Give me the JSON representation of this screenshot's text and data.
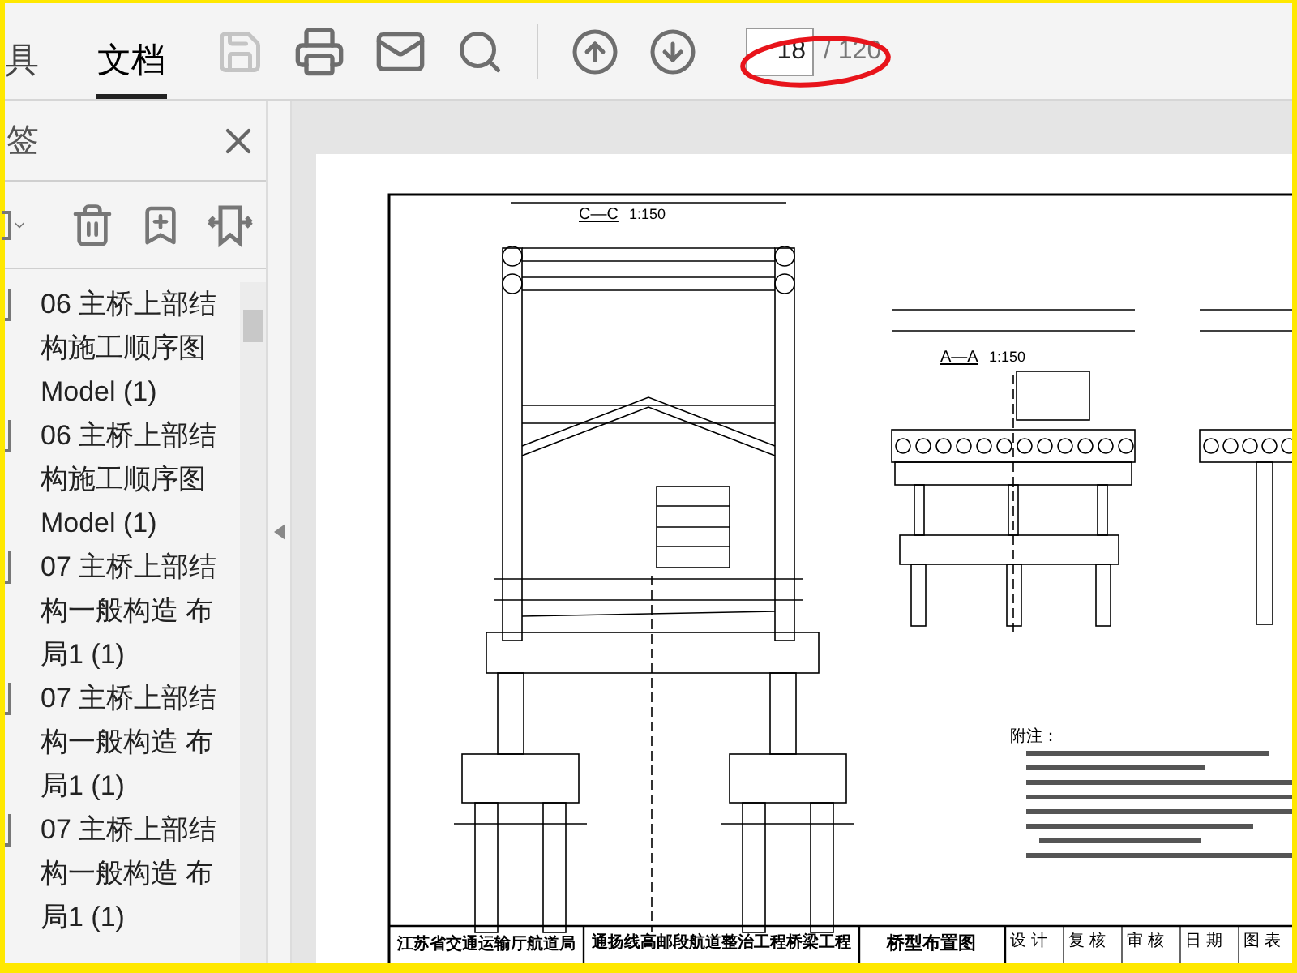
{
  "toolbar": {
    "tabs": [
      {
        "label": "具",
        "selected": false
      },
      {
        "label": "文档",
        "selected": true
      }
    ],
    "save_disabled": true,
    "page_input": {
      "value": "18"
    },
    "page_total": "/ 120"
  },
  "bookmarks": {
    "title": "签",
    "items": [
      {
        "label": "06 主桥上部结构施工顺序图 Model (1)"
      },
      {
        "label": "06 主桥上部结构施工顺序图 Model (1)"
      },
      {
        "label": "07 主桥上部结构一般构造 布局1 (1)"
      },
      {
        "label": "07 主桥上部结构一般构造 布局1 (1)"
      },
      {
        "label": "07 主桥上部结构一般构造 布局1 (1)"
      }
    ]
  },
  "document": {
    "section_cc": {
      "title": "C—C",
      "scale": "1:150"
    },
    "section_aa": {
      "title": "A—A",
      "scale": "1:150"
    },
    "notes_title": "附注：",
    "title_block": {
      "org": "江苏省交通运输厅航道局",
      "project": "通扬线高邮段航道整治工程桥梁工程",
      "drawing_title": "桥型布置图",
      "signatures": [
        "设 计",
        "复 核",
        "审 核",
        "日 期",
        "图 表"
      ]
    }
  }
}
